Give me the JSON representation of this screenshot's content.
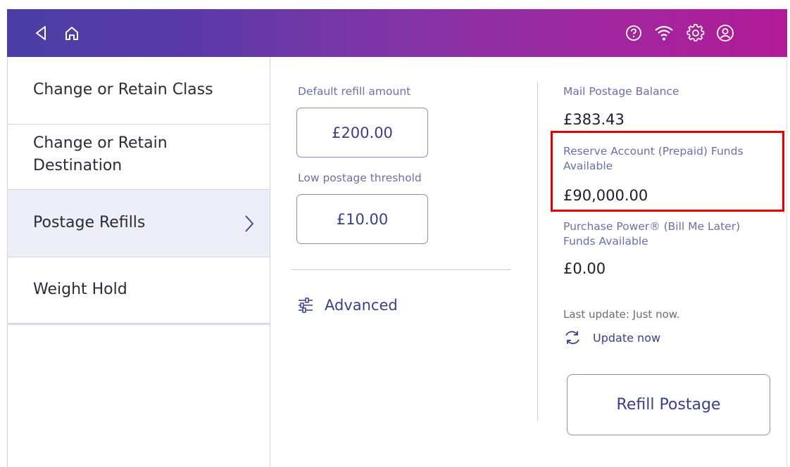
{
  "header": {
    "icons": [
      "back-icon",
      "home-icon",
      "help-icon",
      "wifi-icon",
      "settings-icon",
      "account-icon"
    ]
  },
  "sidebar": {
    "items": [
      {
        "label": "Change or Retain Class"
      },
      {
        "label_line1": "Change or Retain",
        "label_line2": "Destination"
      },
      {
        "label": "Postage Refills",
        "active": true
      },
      {
        "label": "Weight Hold"
      }
    ]
  },
  "refills": {
    "default_label": "Default refill amount",
    "default_value": "£200.00",
    "threshold_label": "Low postage threshold",
    "threshold_value": "£10.00",
    "advanced_label": "Advanced"
  },
  "balances": {
    "mail_label": "Mail Postage Balance",
    "mail_value": "£383.43",
    "reserve_label_line1": "Reserve Account (Prepaid) Funds",
    "reserve_label_line2": "Available",
    "reserve_value": "£90,000.00",
    "purchase_label_line1": "Purchase Power® (Bill Me Later)",
    "purchase_label_line2": "Funds Available",
    "purchase_value": "£0.00",
    "last_update": "Last update: Just now.",
    "update_now": "Update now",
    "refill_button": "Refill Postage"
  },
  "colors": {
    "accent": "#3a3f86",
    "highlight": "#e00000",
    "header_start": "#4a3fa6",
    "header_end": "#b21b97"
  }
}
